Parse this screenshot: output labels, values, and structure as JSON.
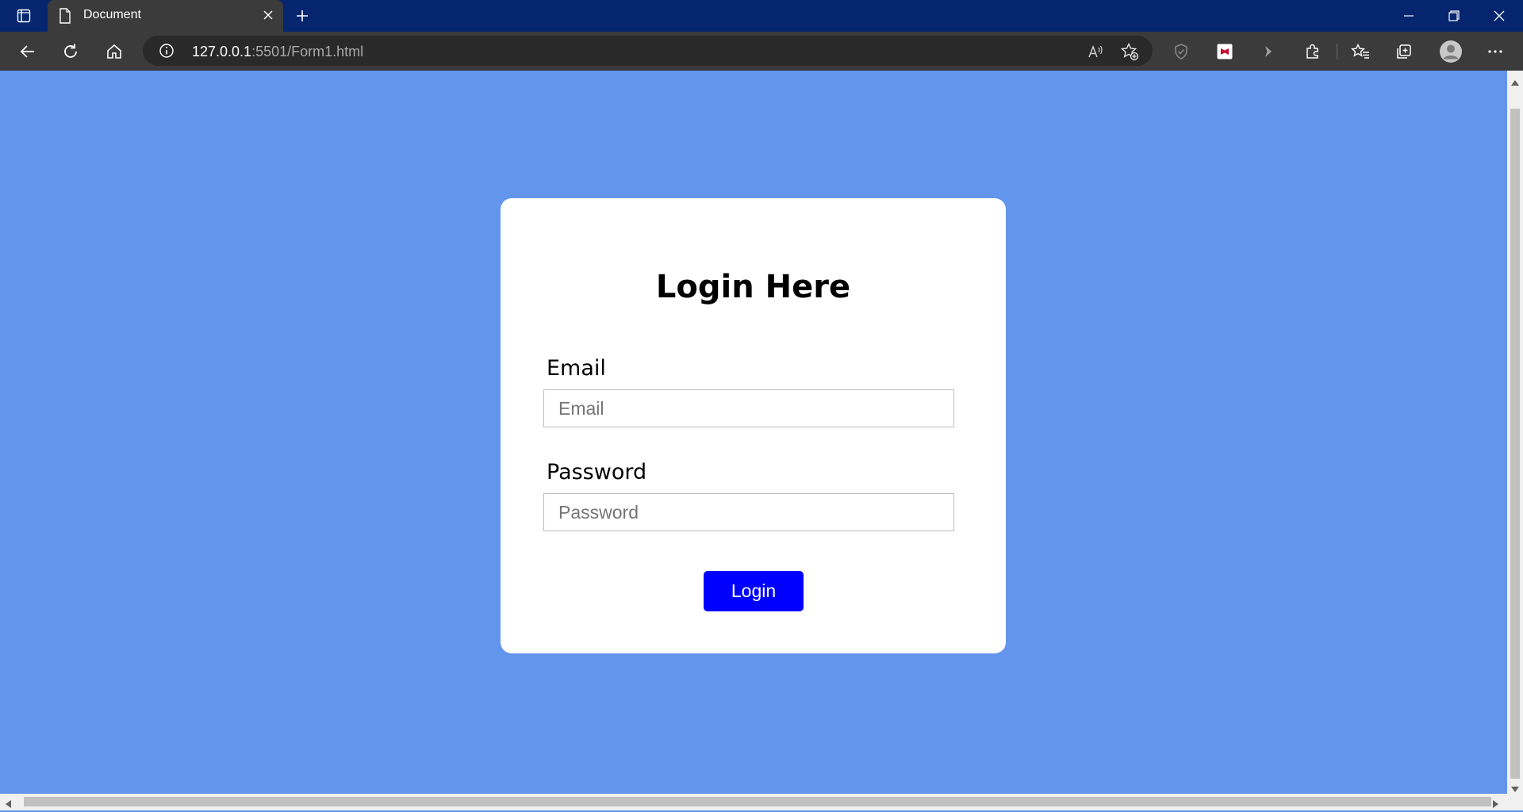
{
  "browser": {
    "tab": {
      "title": "Document"
    },
    "address": {
      "url_host": "127.0.0.1",
      "url_path": ":5501/Form1.html"
    }
  },
  "icons": {
    "tab_actions": "tab-actions-icon",
    "doc": "document-icon",
    "close": "close-icon",
    "new_tab": "plus-icon",
    "back": "back-arrow-icon",
    "refresh": "refresh-icon",
    "home": "home-icon",
    "info": "info-icon",
    "read_aloud": "read-aloud-icon",
    "add_favorite": "add-favorite-icon",
    "shield": "shield-icon",
    "mcafee": "mcafee-icon",
    "chevron": "chevron-right-icon",
    "extensions": "puzzle-icon",
    "favorites": "favorites-icon",
    "collections": "collections-icon",
    "profile": "profile-icon",
    "more": "more-icon"
  },
  "colors": {
    "page_background": "#6495ED",
    "card_background": "#FFFFFF",
    "button_background": "#0000FF",
    "tabbar_background": "#05256F"
  },
  "form": {
    "title": "Login Here",
    "email_label": "Email",
    "email_placeholder": "Email",
    "password_label": "Password",
    "password_placeholder": "Password",
    "submit_label": "Login"
  }
}
